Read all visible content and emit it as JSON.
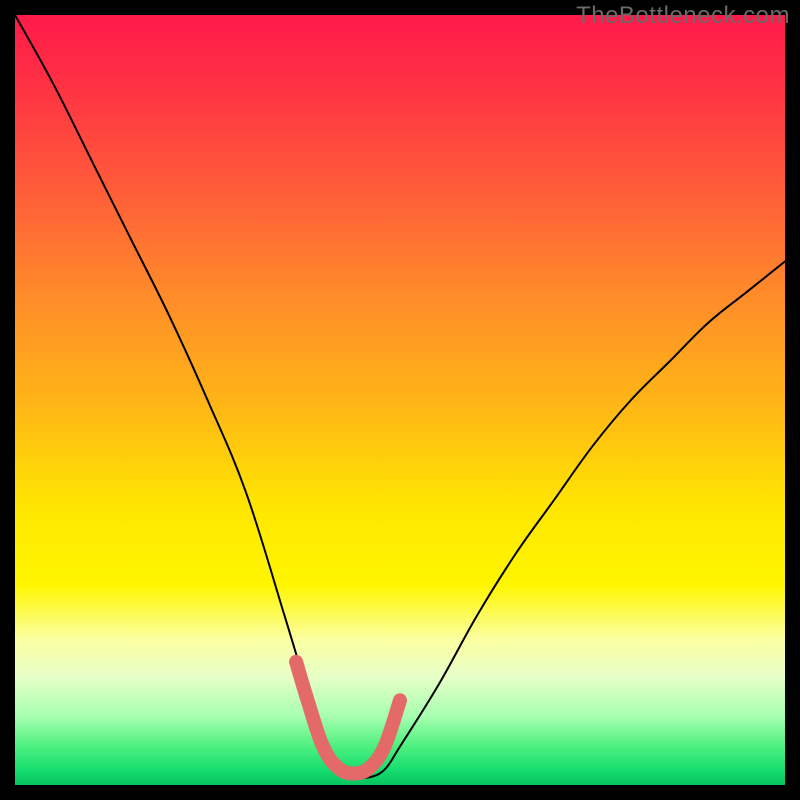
{
  "watermark": "TheBottleneck.com",
  "chart_data": {
    "type": "line",
    "title": "",
    "xlabel": "",
    "ylabel": "",
    "xlim": [
      0,
      100
    ],
    "ylim": [
      0,
      100
    ],
    "series": [
      {
        "name": "bottleneck-curve",
        "x": [
          0,
          5,
          10,
          15,
          20,
          25,
          30,
          35,
          38,
          40,
          42,
          44,
          46,
          48,
          50,
          55,
          60,
          65,
          70,
          75,
          80,
          85,
          90,
          95,
          100
        ],
        "values": [
          100,
          91,
          81,
          71,
          61,
          50,
          38,
          22,
          12,
          5,
          2,
          1,
          1,
          2,
          5,
          13,
          22,
          30,
          37,
          44,
          50,
          55,
          60,
          64,
          68
        ]
      }
    ],
    "highlight": {
      "name": "minimum-region",
      "x": [
        36.5,
        38,
        40,
        42,
        44,
        46,
        48,
        50
      ],
      "values": [
        16,
        11,
        5,
        2.2,
        1.5,
        2.2,
        5,
        11
      ]
    },
    "background_gradient": {
      "stops": [
        {
          "pos": 0.0,
          "color": "#ff1a4a"
        },
        {
          "pos": 0.5,
          "color": "#ffe600"
        },
        {
          "pos": 0.8,
          "color": "#fbffa0"
        },
        {
          "pos": 0.95,
          "color": "#4df07e"
        },
        {
          "pos": 1.0,
          "color": "#06c45d"
        }
      ]
    }
  }
}
